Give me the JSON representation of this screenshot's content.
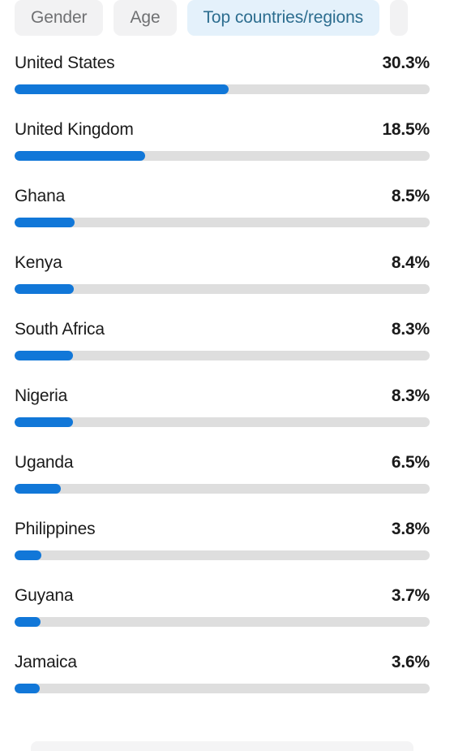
{
  "tabs": [
    {
      "label": "Gender",
      "selected": false
    },
    {
      "label": "Age",
      "selected": false
    },
    {
      "label": "Top countries/regions",
      "selected": true
    },
    {
      "label": "",
      "selected": false,
      "partial": true
    }
  ],
  "colors": {
    "bar_fill": "#1177d8",
    "bar_track": "#dedede",
    "tab_selected_bg": "#e4f1fb",
    "tab_selected_text": "#2c6d8f",
    "tab_bg": "#f2f2f3",
    "tab_text": "#6f7072",
    "page_bg": "#ffffff",
    "text": "#1a1a1a"
  },
  "chart_data": {
    "type": "bar",
    "title": "Top countries/regions",
    "xlabel": "",
    "ylabel": "",
    "orientation": "horizontal",
    "value_suffix": "%",
    "xlim": [
      0,
      100
    ],
    "grid": false,
    "legend": "none",
    "categories": [
      "United States",
      "United Kingdom",
      "Ghana",
      "Kenya",
      "South Africa",
      "Nigeria",
      "Uganda",
      "Philippines",
      "Guyana",
      "Jamaica"
    ],
    "values": [
      30.3,
      18.5,
      8.5,
      8.4,
      8.3,
      8.3,
      6.5,
      3.8,
      3.7,
      3.6
    ],
    "labels": [
      "30.3%",
      "18.5%",
      "8.5%",
      "8.4%",
      "8.3%",
      "8.3%",
      "6.5%",
      "3.8%",
      "3.7%",
      "3.6%"
    ]
  },
  "rows": [
    {
      "country": "United States",
      "pct": "30.3%",
      "value": 30.3
    },
    {
      "country": "United Kingdom",
      "pct": "18.5%",
      "value": 18.5
    },
    {
      "country": "Ghana",
      "pct": "8.5%",
      "value": 8.5
    },
    {
      "country": "Kenya",
      "pct": "8.4%",
      "value": 8.4
    },
    {
      "country": "South Africa",
      "pct": "8.3%",
      "value": 8.3
    },
    {
      "country": "Nigeria",
      "pct": "8.3%",
      "value": 8.3
    },
    {
      "country": "Uganda",
      "pct": "6.5%",
      "value": 6.5
    },
    {
      "country": "Philippines",
      "pct": "3.8%",
      "value": 3.8
    },
    {
      "country": "Guyana",
      "pct": "3.7%",
      "value": 3.7
    },
    {
      "country": "Jamaica",
      "pct": "3.6%",
      "value": 3.6
    }
  ]
}
